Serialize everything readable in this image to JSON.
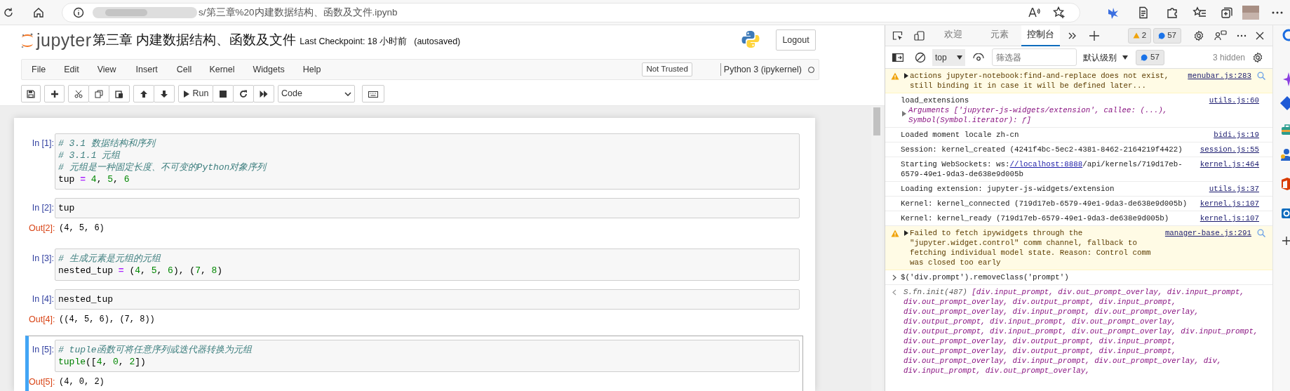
{
  "browser": {
    "url": "s/第三章%20内建数据结构、函数及文件.ipynb"
  },
  "notebook": {
    "logo_text": "jupyter",
    "title": "第三章 内建数据结构、函数及文件",
    "checkpoint": "Last Checkpoint: 18 小时前",
    "autosave": "(autosaved)",
    "logout": "Logout",
    "menu": [
      "File",
      "Edit",
      "View",
      "Insert",
      "Cell",
      "Kernel",
      "Widgets",
      "Help"
    ],
    "trust": "Not Trusted",
    "kernel": "Python 3 (ipykernel)",
    "kernel_busy": false,
    "toolbar": {
      "run": "Run",
      "cell_type": "Code"
    },
    "cells": [
      {
        "prompt": "In [1]:",
        "selected": false,
        "lines": [
          [
            {
              "kind": "comment",
              "text": "# 3.1 数据结构和序列"
            }
          ],
          [
            {
              "kind": "comment",
              "text": "# 3.1.1 元组"
            }
          ],
          [
            {
              "kind": "comment",
              "text": "# 元组是一种固定长度、不可变的Python对象序列"
            }
          ],
          [
            {
              "kind": "name",
              "text": "tup "
            },
            {
              "kind": "op",
              "text": "="
            },
            {
              "kind": "number",
              "text": " 4"
            },
            {
              "kind": "name",
              "text": ", "
            },
            {
              "kind": "number",
              "text": "5"
            },
            {
              "kind": "name",
              "text": ", "
            },
            {
              "kind": "number",
              "text": "6"
            }
          ]
        ]
      },
      {
        "prompt": "In [2]:",
        "selected": false,
        "lines": [
          [
            {
              "kind": "name",
              "text": "tup"
            }
          ]
        ],
        "output_prompt": "Out[2]:",
        "output": "(4, 5, 6)"
      },
      {
        "prompt": "In [3]:",
        "selected": false,
        "lines": [
          [
            {
              "kind": "comment",
              "text": "# 生成元素是元组的元组"
            }
          ],
          [
            {
              "kind": "name",
              "text": "nested_tup "
            },
            {
              "kind": "op",
              "text": "="
            },
            {
              "kind": "name",
              "text": " ("
            },
            {
              "kind": "number",
              "text": "4"
            },
            {
              "kind": "name",
              "text": ", "
            },
            {
              "kind": "number",
              "text": "5"
            },
            {
              "kind": "name",
              "text": ", "
            },
            {
              "kind": "number",
              "text": "6"
            },
            {
              "kind": "name",
              "text": "), ("
            },
            {
              "kind": "number",
              "text": "7"
            },
            {
              "kind": "name",
              "text": ", "
            },
            {
              "kind": "number",
              "text": "8"
            },
            {
              "kind": "name",
              "text": ")"
            }
          ]
        ]
      },
      {
        "prompt": "In [4]:",
        "selected": false,
        "lines": [
          [
            {
              "kind": "name",
              "text": "nested_tup"
            }
          ]
        ],
        "output_prompt": "Out[4]:",
        "output": "((4, 5, 6), (7, 8))"
      },
      {
        "prompt": "In [5]:",
        "selected": true,
        "lines": [
          [
            {
              "kind": "comment",
              "text": "# tuple函数可将任意序列或迭代器转换为元组"
            }
          ],
          [
            {
              "kind": "builtin",
              "text": "tuple"
            },
            {
              "kind": "name",
              "text": "(["
            },
            {
              "kind": "number",
              "text": "4"
            },
            {
              "kind": "name",
              "text": ", "
            },
            {
              "kind": "number",
              "text": "0"
            },
            {
              "kind": "name",
              "text": ", "
            },
            {
              "kind": "number",
              "text": "2"
            },
            {
              "kind": "name",
              "text": "])"
            }
          ]
        ],
        "output_prompt": "Out[5]:",
        "output": "(4, 0, 2)"
      }
    ]
  },
  "devtools": {
    "tabs": [
      {
        "label": "欢迎",
        "selected": false
      },
      {
        "label": "元素",
        "selected": false
      },
      {
        "label": "控制台",
        "selected": true
      }
    ],
    "warnings": "2",
    "messages": "57",
    "context": "top",
    "filter_placeholder": "筛选器",
    "level": "默认级别",
    "filter_messages": "57",
    "hidden": "3 hidden",
    "console": [
      {
        "kind": "warning",
        "expandable": true,
        "text": "actions jupyter-notebook:find-and-replace does not exist, still binding it in case it will be defined later...",
        "source": "menubar.js:283"
      },
      {
        "kind": "log",
        "text": "load_extensions",
        "source": "utils.js:60",
        "detail": "Arguments ['jupyter-js-widgets/extension', callee: (...), Symbol(Symbol.iterator): ƒ]"
      },
      {
        "kind": "log",
        "text": "Loaded moment locale zh-cn",
        "source": "bidi.js:19"
      },
      {
        "kind": "log",
        "text": "Session: kernel_created (4241f4bc-5ec2-4381-8462-2164219f4422)",
        "source": "session.js:55"
      },
      {
        "kind": "log",
        "text": "Starting WebSockets: ws:",
        "link": "//localhost:8888",
        "after": "/api/kernels/719d17eb-6579-49e1-9da3-de638e9d005b",
        "source": "kernel.js:464"
      },
      {
        "kind": "log",
        "text": "Loading extension: jupyter-js-widgets/extension",
        "source": "utils.js:37"
      },
      {
        "kind": "log",
        "text": "Kernel: kernel_connected (719d17eb-6579-49e1-9da3-de638e9d005b)",
        "source": "kernel.js:107"
      },
      {
        "kind": "log",
        "text": "Kernel: kernel_ready (719d17eb-6579-49e1-9da3-de638e9d005b)",
        "source": "kernel.js:107"
      },
      {
        "kind": "warning",
        "expandable": true,
        "text": "Failed to fetch ipywidgets through the \"jupyter.widget.control\" comm channel, fallback to fetching individual model state. Reason: Control comm was closed too early",
        "source": "manager-base.js:291"
      },
      {
        "kind": "command",
        "text": "$('div.prompt').removeClass('prompt')"
      },
      {
        "kind": "result",
        "summary": "S.fn.init(487)",
        "text": "[div.input_prompt, div.out_prompt_overlay, div.input_prompt, div.out_prompt_overlay, div.output_prompt, div.input_prompt, div.out_prompt_overlay, div.input_prompt, div.out_prompt_overlay, div.output_prompt, div.input_prompt, div.out_prompt_overlay, div.output_prompt, div.input_prompt, div.out_prompt_overlay, div.input_prompt, div.out_prompt_overlay, div.output_prompt, div.input_prompt, div.out_prompt_overlay, div.output_prompt, div.input_prompt, div.out_prompt_overlay, div.input_prompt, div.out_prompt_overlay, div, div.input_prompt, div.out_prompt_overlay,"
      }
    ]
  }
}
